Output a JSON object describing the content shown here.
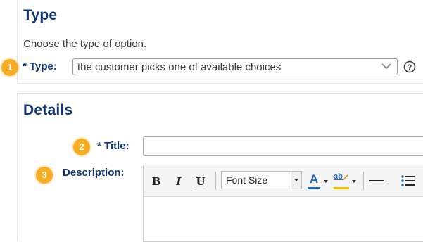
{
  "type_section": {
    "heading": "Type",
    "description": "Choose the type of option.",
    "badge": "1",
    "label": "* Type:",
    "select_value": "the customer picks one of available choices",
    "help_glyph": "?"
  },
  "details_section": {
    "heading": "Details",
    "title_field": {
      "badge": "2",
      "label": "* Title:",
      "value": ""
    },
    "description_field": {
      "badge": "3",
      "label": "Description:",
      "toolbar": {
        "bold": "B",
        "italic": "I",
        "underline": "U",
        "font_size": "Font Size",
        "font_color_glyph": "A",
        "highlight_glyph": "ab"
      }
    }
  },
  "colors": {
    "heading": "#0d3673",
    "badge": "#f6ad21",
    "font_color_underline": "#1f64b8",
    "highlight_underline": "#f2c200"
  }
}
